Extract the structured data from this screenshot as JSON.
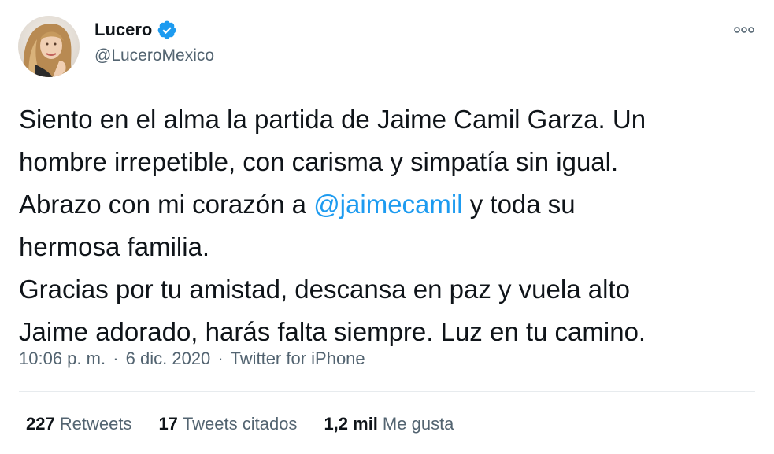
{
  "author": {
    "display_name": "Lucero",
    "handle": "@LuceroMexico",
    "verified": true,
    "verified_icon": "verified-badge-icon",
    "avatar": "profile-photo"
  },
  "menu_icon": "more-options-icon",
  "tweet": {
    "lines": [
      "Siento en el alma la partida de Jaime Camil Garza. Un",
      "hombre irrepetible, con carisma y simpatía sin igual.",
      "Abrazo con mi corazón a ",
      "hermosa familia.",
      "Gracias por tu amistad, descansa en paz y vuela alto",
      "Jaime adorado, harás falta siempre. Luz en tu camino."
    ],
    "mention": "@jaimecamil",
    "after_mention": " y toda su"
  },
  "meta": {
    "time": "10:06 p. m.",
    "separator": "·",
    "date": "6 dic. 2020",
    "source": "Twitter for iPhone"
  },
  "stats": {
    "retweets_count": "227",
    "retweets_label": "Retweets",
    "quotes_count": "17",
    "quotes_label": "Tweets citados",
    "likes_count": "1,2 mil",
    "likes_label": "Me gusta"
  },
  "colors": {
    "accent": "#1d9bf0",
    "text": "#0f1419",
    "secondary": "#536471"
  }
}
